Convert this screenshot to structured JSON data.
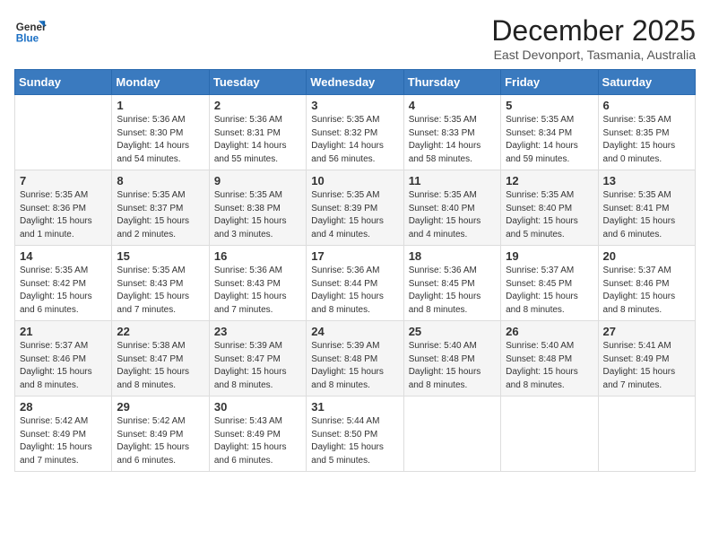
{
  "logo": {
    "line1": "General",
    "line2": "Blue"
  },
  "title": "December 2025",
  "location": "East Devonport, Tasmania, Australia",
  "days_header": [
    "Sunday",
    "Monday",
    "Tuesday",
    "Wednesday",
    "Thursday",
    "Friday",
    "Saturday"
  ],
  "weeks": [
    [
      {
        "num": "",
        "info": ""
      },
      {
        "num": "1",
        "info": "Sunrise: 5:36 AM\nSunset: 8:30 PM\nDaylight: 14 hours\nand 54 minutes."
      },
      {
        "num": "2",
        "info": "Sunrise: 5:36 AM\nSunset: 8:31 PM\nDaylight: 14 hours\nand 55 minutes."
      },
      {
        "num": "3",
        "info": "Sunrise: 5:35 AM\nSunset: 8:32 PM\nDaylight: 14 hours\nand 56 minutes."
      },
      {
        "num": "4",
        "info": "Sunrise: 5:35 AM\nSunset: 8:33 PM\nDaylight: 14 hours\nand 58 minutes."
      },
      {
        "num": "5",
        "info": "Sunrise: 5:35 AM\nSunset: 8:34 PM\nDaylight: 14 hours\nand 59 minutes."
      },
      {
        "num": "6",
        "info": "Sunrise: 5:35 AM\nSunset: 8:35 PM\nDaylight: 15 hours\nand 0 minutes."
      }
    ],
    [
      {
        "num": "7",
        "info": "Sunrise: 5:35 AM\nSunset: 8:36 PM\nDaylight: 15 hours\nand 1 minute."
      },
      {
        "num": "8",
        "info": "Sunrise: 5:35 AM\nSunset: 8:37 PM\nDaylight: 15 hours\nand 2 minutes."
      },
      {
        "num": "9",
        "info": "Sunrise: 5:35 AM\nSunset: 8:38 PM\nDaylight: 15 hours\nand 3 minutes."
      },
      {
        "num": "10",
        "info": "Sunrise: 5:35 AM\nSunset: 8:39 PM\nDaylight: 15 hours\nand 4 minutes."
      },
      {
        "num": "11",
        "info": "Sunrise: 5:35 AM\nSunset: 8:40 PM\nDaylight: 15 hours\nand 4 minutes."
      },
      {
        "num": "12",
        "info": "Sunrise: 5:35 AM\nSunset: 8:40 PM\nDaylight: 15 hours\nand 5 minutes."
      },
      {
        "num": "13",
        "info": "Sunrise: 5:35 AM\nSunset: 8:41 PM\nDaylight: 15 hours\nand 6 minutes."
      }
    ],
    [
      {
        "num": "14",
        "info": "Sunrise: 5:35 AM\nSunset: 8:42 PM\nDaylight: 15 hours\nand 6 minutes."
      },
      {
        "num": "15",
        "info": "Sunrise: 5:35 AM\nSunset: 8:43 PM\nDaylight: 15 hours\nand 7 minutes."
      },
      {
        "num": "16",
        "info": "Sunrise: 5:36 AM\nSunset: 8:43 PM\nDaylight: 15 hours\nand 7 minutes."
      },
      {
        "num": "17",
        "info": "Sunrise: 5:36 AM\nSunset: 8:44 PM\nDaylight: 15 hours\nand 8 minutes."
      },
      {
        "num": "18",
        "info": "Sunrise: 5:36 AM\nSunset: 8:45 PM\nDaylight: 15 hours\nand 8 minutes."
      },
      {
        "num": "19",
        "info": "Sunrise: 5:37 AM\nSunset: 8:45 PM\nDaylight: 15 hours\nand 8 minutes."
      },
      {
        "num": "20",
        "info": "Sunrise: 5:37 AM\nSunset: 8:46 PM\nDaylight: 15 hours\nand 8 minutes."
      }
    ],
    [
      {
        "num": "21",
        "info": "Sunrise: 5:37 AM\nSunset: 8:46 PM\nDaylight: 15 hours\nand 8 minutes."
      },
      {
        "num": "22",
        "info": "Sunrise: 5:38 AM\nSunset: 8:47 PM\nDaylight: 15 hours\nand 8 minutes."
      },
      {
        "num": "23",
        "info": "Sunrise: 5:39 AM\nSunset: 8:47 PM\nDaylight: 15 hours\nand 8 minutes."
      },
      {
        "num": "24",
        "info": "Sunrise: 5:39 AM\nSunset: 8:48 PM\nDaylight: 15 hours\nand 8 minutes."
      },
      {
        "num": "25",
        "info": "Sunrise: 5:40 AM\nSunset: 8:48 PM\nDaylight: 15 hours\nand 8 minutes."
      },
      {
        "num": "26",
        "info": "Sunrise: 5:40 AM\nSunset: 8:48 PM\nDaylight: 15 hours\nand 8 minutes."
      },
      {
        "num": "27",
        "info": "Sunrise: 5:41 AM\nSunset: 8:49 PM\nDaylight: 15 hours\nand 7 minutes."
      }
    ],
    [
      {
        "num": "28",
        "info": "Sunrise: 5:42 AM\nSunset: 8:49 PM\nDaylight: 15 hours\nand 7 minutes."
      },
      {
        "num": "29",
        "info": "Sunrise: 5:42 AM\nSunset: 8:49 PM\nDaylight: 15 hours\nand 6 minutes."
      },
      {
        "num": "30",
        "info": "Sunrise: 5:43 AM\nSunset: 8:49 PM\nDaylight: 15 hours\nand 6 minutes."
      },
      {
        "num": "31",
        "info": "Sunrise: 5:44 AM\nSunset: 8:50 PM\nDaylight: 15 hours\nand 5 minutes."
      },
      {
        "num": "",
        "info": ""
      },
      {
        "num": "",
        "info": ""
      },
      {
        "num": "",
        "info": ""
      }
    ]
  ]
}
